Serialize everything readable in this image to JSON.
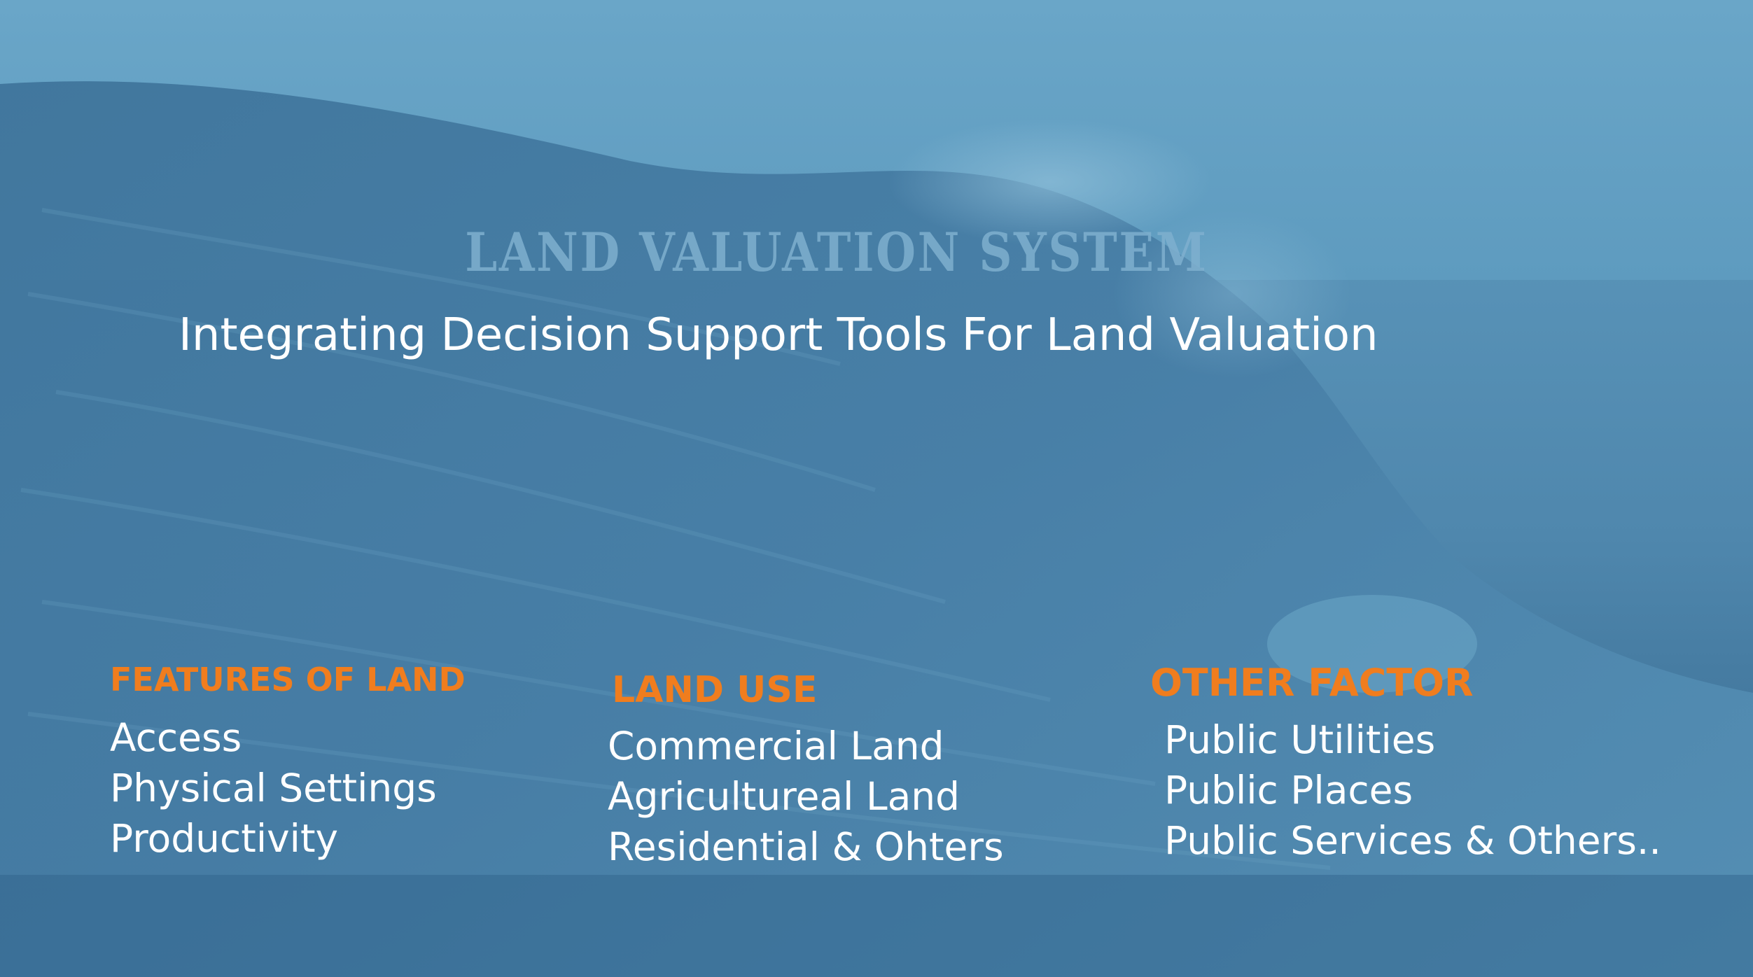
{
  "slide": {
    "title": "LAND VALUATION SYSTEM",
    "subtitle": "Integrating Decision Support Tools For Land Valuation",
    "columns": [
      {
        "heading": "FEATURES OF LAND",
        "items": [
          "Access",
          "Physical Settings",
          "Productivity"
        ]
      },
      {
        "heading": "LAND USE",
        "items": [
          "Commercial Land",
          "Agricultureal Land",
          "Residential & Ohters"
        ]
      },
      {
        "heading": "OTHER FACTOR",
        "items": [
          "Public Utilities",
          "Public Places",
          "Public Services & Others.."
        ]
      }
    ]
  },
  "colors": {
    "background": "#5791b6",
    "title": "#7fb0cf",
    "heading": "#f07d1e",
    "text": "#ffffff"
  },
  "background_image": "ocean-wave"
}
